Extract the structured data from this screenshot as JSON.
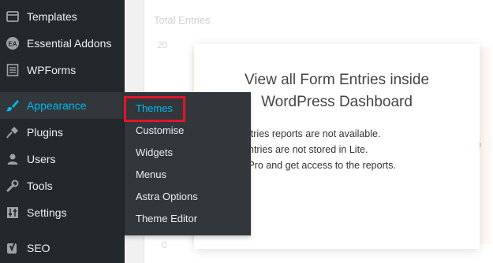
{
  "sidebar": {
    "items": [
      {
        "label": "Templates",
        "icon": "templates-icon"
      },
      {
        "label": "Essential Addons",
        "icon": "ea-icon"
      },
      {
        "label": "WPForms",
        "icon": "wpforms-icon"
      },
      {
        "label": "Appearance",
        "icon": "brush-icon",
        "active": true
      },
      {
        "label": "Plugins",
        "icon": "plug-icon"
      },
      {
        "label": "Users",
        "icon": "user-icon"
      },
      {
        "label": "Tools",
        "icon": "wrench-icon"
      },
      {
        "label": "Settings",
        "icon": "settings-icon"
      },
      {
        "label": "SEO",
        "icon": "yoast-icon"
      }
    ]
  },
  "appearance_submenu": {
    "items": [
      {
        "label": "Themes",
        "current": true
      },
      {
        "label": "Customise"
      },
      {
        "label": "Widgets"
      },
      {
        "label": "Menus"
      },
      {
        "label": "Astra Options"
      },
      {
        "label": "Theme Editor"
      }
    ]
  },
  "main": {
    "panel_title": "Total Entries",
    "y_top": "20",
    "y_bottom": "0",
    "modal": {
      "title": "View all Form Entries inside WordPress Dashboard",
      "lines": [
        "m entries reports are not available.",
        "rm entries are not stored in Lite.",
        "e to Pro and get access to the reports."
      ]
    }
  },
  "colors": {
    "sidebar_bg": "#23282d",
    "active_text": "#00b9eb",
    "highlight": "#e3142b"
  }
}
